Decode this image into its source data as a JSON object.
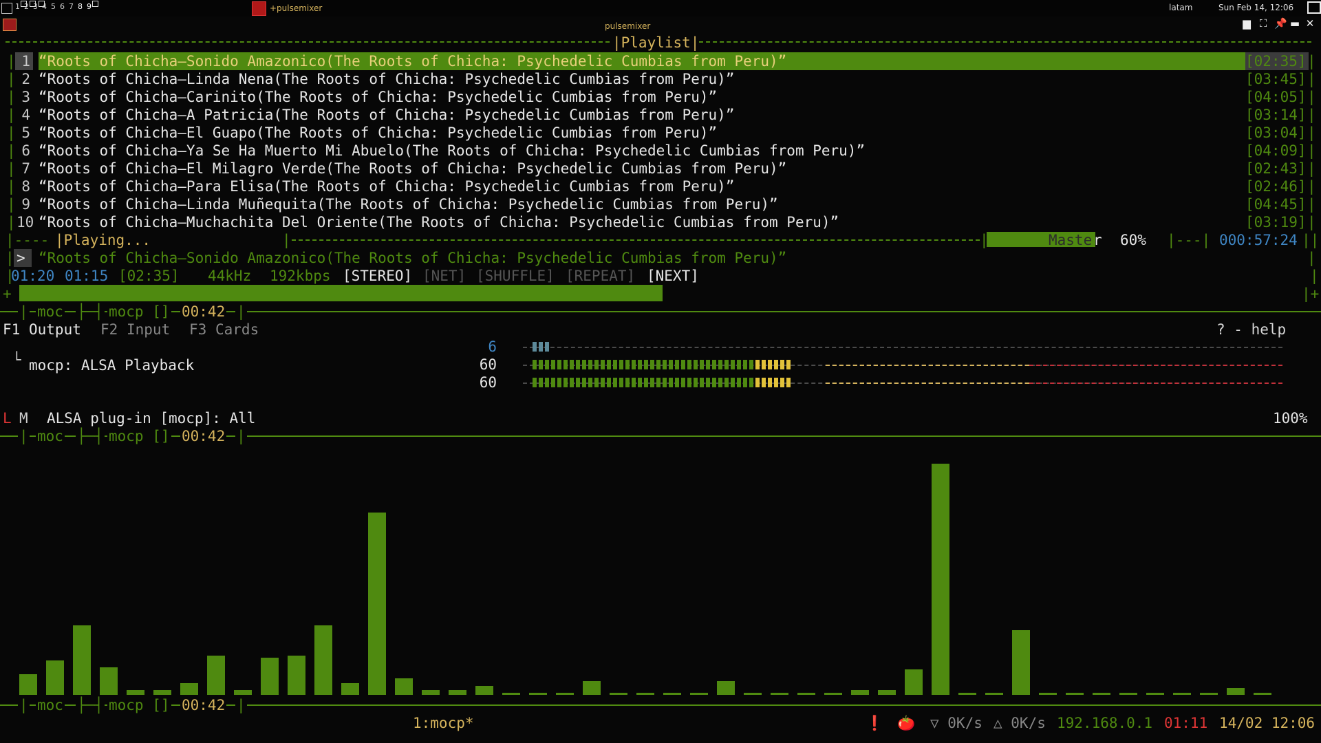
{
  "topbar": {
    "workspaces": [
      "1",
      "2",
      "3",
      "4",
      "5",
      "6",
      "7",
      "8",
      "9"
    ],
    "task_title": "+pulsemixer",
    "layout": "latam",
    "clock": "Sun Feb 14, 12:06"
  },
  "window": {
    "title": "pulsemixer"
  },
  "moc": {
    "playlist_title": "|Playlist|",
    "tracks": [
      {
        "num": "1",
        "title": "“Roots of Chicha—Sonido Amazonico(The Roots of Chicha: Psychedelic Cumbias from Peru)”",
        "time": "[02:35]"
      },
      {
        "num": "2",
        "title": "“Roots of Chicha—Linda Nena(The Roots of Chicha: Psychedelic Cumbias from Peru)”",
        "time": "[03:45]"
      },
      {
        "num": "3",
        "title": "“Roots of Chicha—Carinito(The Roots of Chicha: Psychedelic Cumbias from Peru)”",
        "time": "[04:05]"
      },
      {
        "num": "4",
        "title": "“Roots of Chicha—A Patricia(The Roots of Chicha: Psychedelic Cumbias from Peru)”",
        "time": "[03:14]"
      },
      {
        "num": "5",
        "title": "“Roots of Chicha—El Guapo(The Roots of Chicha: Psychedelic Cumbias from Peru)”",
        "time": "[03:04]"
      },
      {
        "num": "6",
        "title": "“Roots of Chicha—Ya Se Ha Muerto Mi Abuelo(The Roots of Chicha: Psychedelic Cumbias from Peru)”",
        "time": "[04:09]"
      },
      {
        "num": "7",
        "title": "“Roots of Chicha—El Milagro Verde(The Roots of Chicha: Psychedelic Cumbias from Peru)”",
        "time": "[02:43]"
      },
      {
        "num": "8",
        "title": "“Roots of Chicha—Para Elisa(The Roots of Chicha: Psychedelic Cumbias from Peru)”",
        "time": "[02:46]"
      },
      {
        "num": "9",
        "title": "“Roots of Chicha—Linda Muñequita(The Roots of Chicha: Psychedelic Cumbias from Peru)”",
        "time": "[04:45]"
      },
      {
        "num": "10",
        "title": "“Roots of Chicha—Muchachita Del Oriente(The Roots of Chicha: Psychedelic Cumbias from Peru)”",
        "time": "[03:19]"
      }
    ],
    "status": "|Playing...",
    "mixer_label": "Maste",
    "mixer_label_tail": "r",
    "mixer_percent": "60%",
    "total_time": "000:57:24",
    "now_arrow": ">",
    "now_playing": "“Roots of Chicha—Sonido Amazonico(The Roots of Chicha: Psychedelic Cumbias from Peru)”",
    "info": {
      "elapsed": "01:20",
      "remaining": "01:15",
      "total": "[02:35]",
      "rate": "44kHz",
      "bitrate": "192kbps",
      "stereo": "[STEREO]",
      "net": "[NET]",
      "shuffle": "[SHUFFLE]",
      "repeat": "[REPEAT]",
      "next": "[NEXT]"
    },
    "progress": 0.5
  },
  "tmux": {
    "session": "moc",
    "window": "mocp []",
    "time": "00:42"
  },
  "pulsemixer": {
    "tabs": [
      {
        "key": "F1",
        "label": "Output",
        "active": true
      },
      {
        "key": "F2",
        "label": "Input",
        "active": false
      },
      {
        "key": "F3",
        "label": "Cards",
        "active": false
      }
    ],
    "help": "? - help",
    "stream": "mocp: ALSA Playback",
    "meters": [
      {
        "value": "6",
        "level": 0.02
      },
      {
        "value": "60",
        "level": 0.6
      },
      {
        "value": "60",
        "level": 0.6
      }
    ],
    "device": {
      "L": "L",
      "M": "M",
      "name": "ALSA plug-in [mocp]: All",
      "percent": "100%"
    }
  },
  "visualizer": {
    "levels": [
      0.09,
      0.15,
      0.3,
      0.12,
      0.02,
      0.02,
      0.05,
      0.17,
      0.02,
      0.16,
      0.17,
      0.3,
      0.05,
      0.79,
      0.07,
      0.02,
      0.02,
      0.04,
      0,
      0.01,
      0,
      0.06,
      0,
      0,
      0,
      0,
      0.06,
      0,
      0,
      0.01,
      0,
      0.02,
      0.02,
      0.11,
      1.0,
      0,
      0,
      0.28,
      0,
      0,
      0,
      0,
      0,
      0,
      0,
      0.03,
      0
    ]
  },
  "bottombar": {
    "window": "1:mocp*",
    "alert": "❗",
    "tomato": "🍅",
    "down": "▽ 0K/s",
    "up": "△ 0K/s",
    "ip": "192.168.0.1",
    "timer": "01:11",
    "datetime": "14/02 12:06"
  }
}
